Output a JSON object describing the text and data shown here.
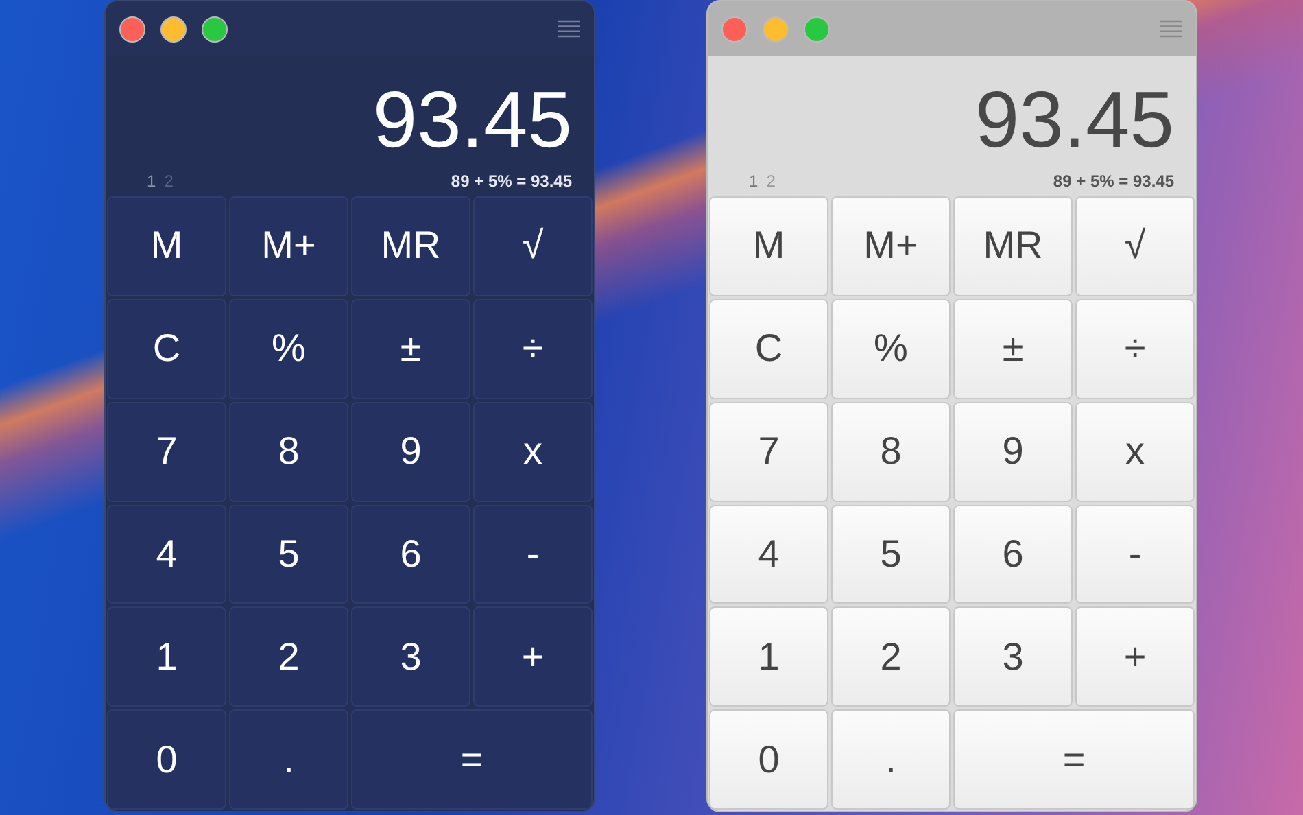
{
  "windows": [
    {
      "kind": "dark",
      "display": "93.45",
      "pages": [
        {
          "label": "1",
          "selected": true
        },
        {
          "label": "2",
          "selected": false
        }
      ],
      "history": "89 + 5% = 93.45",
      "keys": [
        {
          "label": "M",
          "kind": "normal"
        },
        {
          "label": "M+",
          "kind": "normal"
        },
        {
          "label": "MR",
          "kind": "normal"
        },
        {
          "label": "√",
          "kind": "normal"
        },
        {
          "label": "C",
          "kind": "normal"
        },
        {
          "label": "%",
          "kind": "normal"
        },
        {
          "label": "±",
          "kind": "normal"
        },
        {
          "label": "÷",
          "kind": "normal"
        },
        {
          "label": "7",
          "kind": "normal"
        },
        {
          "label": "8",
          "kind": "normal"
        },
        {
          "label": "9",
          "kind": "normal"
        },
        {
          "label": "x",
          "kind": "normal"
        },
        {
          "label": "4",
          "kind": "normal"
        },
        {
          "label": "5",
          "kind": "normal"
        },
        {
          "label": "6",
          "kind": "normal"
        },
        {
          "label": "-",
          "kind": "normal"
        },
        {
          "label": "1",
          "kind": "normal"
        },
        {
          "label": "2",
          "kind": "normal"
        },
        {
          "label": "3",
          "kind": "normal"
        },
        {
          "label": "+",
          "kind": "normal"
        },
        {
          "label": "0",
          "kind": "normal"
        },
        {
          "label": ".",
          "kind": "normal"
        },
        {
          "label": "=",
          "kind": "wide"
        }
      ]
    },
    {
      "kind": "light",
      "display": "93.45",
      "pages": [
        {
          "label": "1",
          "selected": true
        },
        {
          "label": "2",
          "selected": false
        }
      ],
      "history": "89 + 5% = 93.45",
      "keys": [
        {
          "label": "M",
          "kind": "normal"
        },
        {
          "label": "M+",
          "kind": "normal"
        },
        {
          "label": "MR",
          "kind": "normal"
        },
        {
          "label": "√",
          "kind": "normal"
        },
        {
          "label": "C",
          "kind": "normal"
        },
        {
          "label": "%",
          "kind": "normal"
        },
        {
          "label": "±",
          "kind": "normal"
        },
        {
          "label": "÷",
          "kind": "normal"
        },
        {
          "label": "7",
          "kind": "normal"
        },
        {
          "label": "8",
          "kind": "normal"
        },
        {
          "label": "9",
          "kind": "normal"
        },
        {
          "label": "x",
          "kind": "normal"
        },
        {
          "label": "4",
          "kind": "normal"
        },
        {
          "label": "5",
          "kind": "normal"
        },
        {
          "label": "6",
          "kind": "normal"
        },
        {
          "label": "-",
          "kind": "normal"
        },
        {
          "label": "1",
          "kind": "normal"
        },
        {
          "label": "2",
          "kind": "normal"
        },
        {
          "label": "3",
          "kind": "normal"
        },
        {
          "label": "+",
          "kind": "normal"
        },
        {
          "label": "0",
          "kind": "normal"
        },
        {
          "label": ".",
          "kind": "normal"
        },
        {
          "label": "=",
          "kind": "wide"
        }
      ]
    }
  ]
}
